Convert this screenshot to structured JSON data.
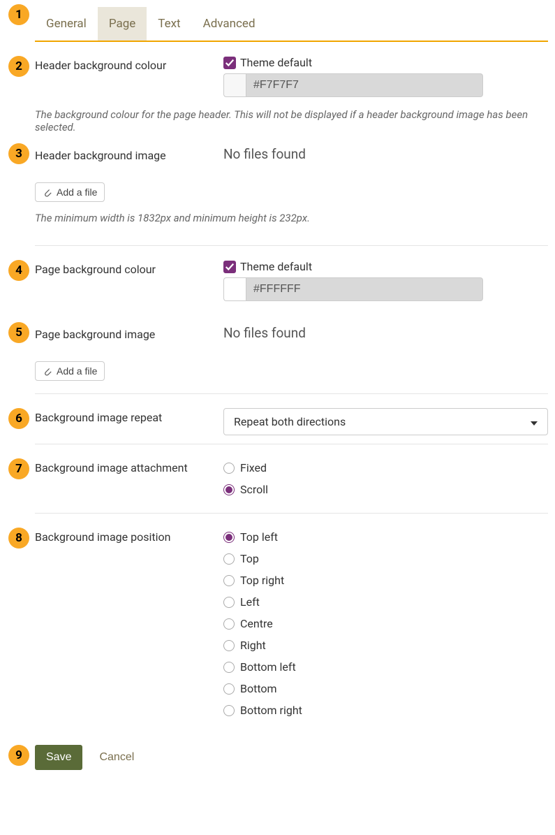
{
  "annotations": [
    "1",
    "2",
    "3",
    "4",
    "5",
    "6",
    "7",
    "8",
    "9"
  ],
  "tabs": {
    "items": [
      {
        "label": "General",
        "active": false
      },
      {
        "label": "Page",
        "active": true
      },
      {
        "label": "Text",
        "active": false
      },
      {
        "label": "Advanced",
        "active": false
      }
    ]
  },
  "fields": {
    "headerBgColour": {
      "label": "Header background colour",
      "themeDefaultLabel": "Theme default",
      "themeDefaultChecked": true,
      "value": "#F7F7F7",
      "help": "The background colour for the page header. This will not be displayed if a header background image has been selected."
    },
    "headerBgImage": {
      "label": "Header background image",
      "status": "No files found",
      "addFileLabel": "Add a file",
      "help": "The minimum width is 1832px and minimum height is 232px."
    },
    "pageBgColour": {
      "label": "Page background colour",
      "themeDefaultLabel": "Theme default",
      "themeDefaultChecked": true,
      "value": "#FFFFFF"
    },
    "pageBgImage": {
      "label": "Page background image",
      "status": "No files found",
      "addFileLabel": "Add a file"
    },
    "bgRepeat": {
      "label": "Background image repeat",
      "selected": "Repeat both directions"
    },
    "bgAttachment": {
      "label": "Background image attachment",
      "options": [
        {
          "label": "Fixed",
          "selected": false
        },
        {
          "label": "Scroll",
          "selected": true
        }
      ]
    },
    "bgPosition": {
      "label": "Background image position",
      "options": [
        {
          "label": "Top left",
          "selected": true
        },
        {
          "label": "Top",
          "selected": false
        },
        {
          "label": "Top right",
          "selected": false
        },
        {
          "label": "Left",
          "selected": false
        },
        {
          "label": "Centre",
          "selected": false
        },
        {
          "label": "Right",
          "selected": false
        },
        {
          "label": "Bottom left",
          "selected": false
        },
        {
          "label": "Bottom",
          "selected": false
        },
        {
          "label": "Bottom right",
          "selected": false
        }
      ]
    }
  },
  "buttons": {
    "save": "Save",
    "cancel": "Cancel"
  }
}
